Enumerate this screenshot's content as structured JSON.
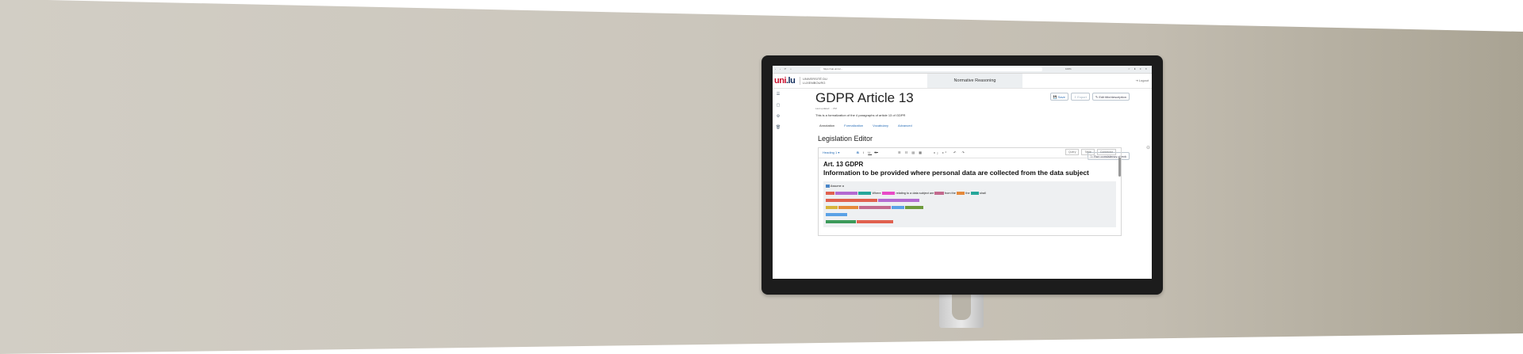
{
  "browser": {
    "url": "https://nai.uni.lu/...",
    "zoom": "100%"
  },
  "header": {
    "logo_mark": "uni",
    "logo_mark_suffix": ".lu",
    "logo_text_line1": "UNIVERSITÉ DU",
    "logo_text_line2": "LUXEMBOURG",
    "app_tab": "Normative Reasoning",
    "logout": "Logout"
  },
  "sidebar": {
    "icons": [
      "menu-icon",
      "document-icon",
      "gear-icon",
      "trash-icon"
    ]
  },
  "document": {
    "title": "GDPR Article 13",
    "updated": "Last updated: ... PM",
    "description": "This is a formalization of the 4 paragraphs of article 13 of GDPR",
    "actions": {
      "save": "Save",
      "export": "Export",
      "edit_description": "Edit title/description"
    },
    "tabs": [
      "Annotation",
      "Formalization",
      "Vocabulary",
      "Advanced"
    ]
  },
  "editor": {
    "title": "Legislation Editor",
    "check_button": "Run consistency check",
    "toolbar": {
      "heading": "Heading 1",
      "heading_value": "",
      "right_boxes": [
        "Query",
        "Table",
        "Connector"
      ]
    },
    "article_title": "Art. 13 GDPR",
    "article_subtitle": "Information to be provided where personal data are collected from the data subject",
    "para_label": "Assume a",
    "tokens": [
      {
        "text": "",
        "color": "blue"
      },
      {
        "text": "",
        "color": "red"
      },
      {
        "text": "",
        "color": "purple"
      },
      {
        "text": "",
        "color": "teal"
      },
      {
        "text": "Where",
        "color": "none"
      },
      {
        "text": "",
        "color": "magenta"
      },
      {
        "text": "relating to a data subject are",
        "color": "none"
      },
      {
        "text": "",
        "color": "mauve"
      },
      {
        "text": "from the",
        "color": "none"
      },
      {
        "text": "",
        "color": "orange"
      },
      {
        "text": "the",
        "color": "none"
      },
      {
        "text": "",
        "color": "teal"
      },
      {
        "text": "shall",
        "color": "none"
      }
    ]
  }
}
